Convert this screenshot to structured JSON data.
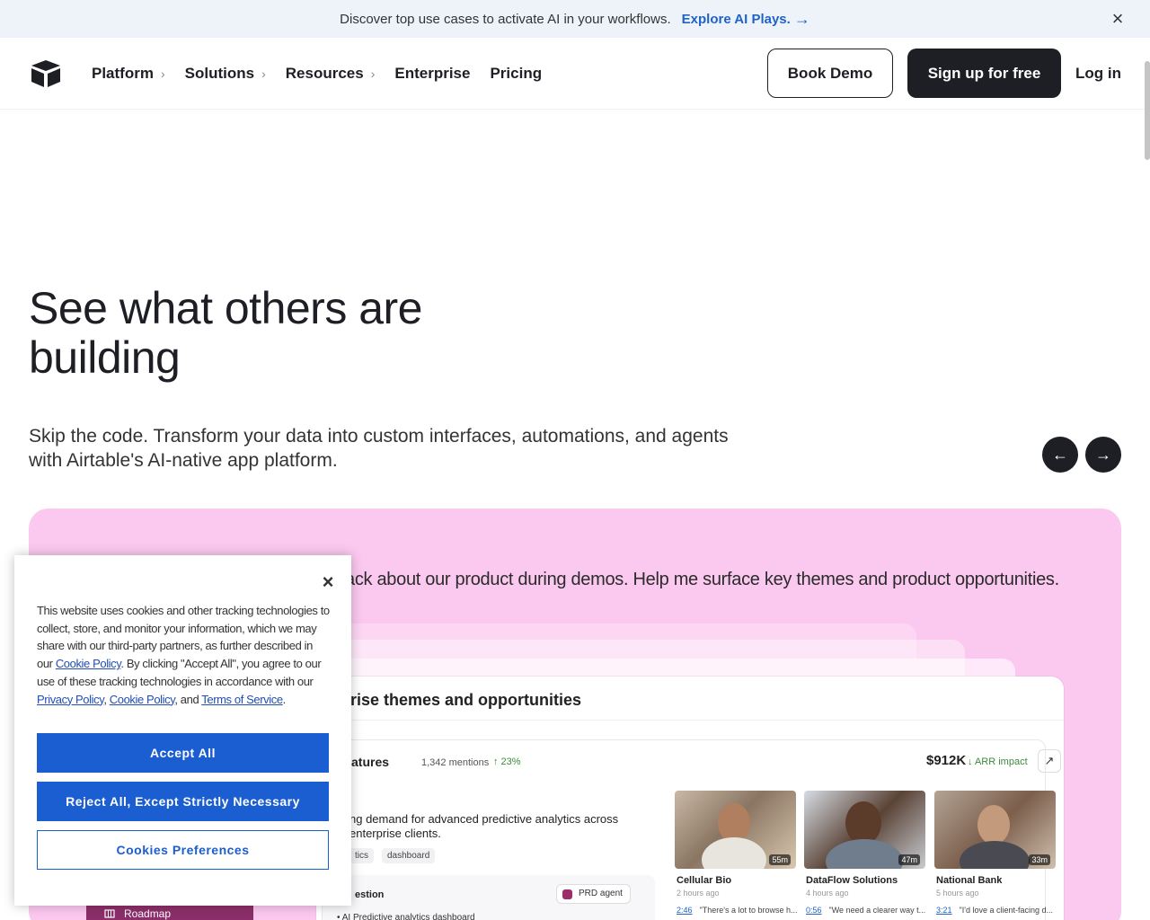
{
  "announcement": {
    "message": "Discover top use cases to activate AI in your workflows.",
    "cta": "Explore AI Plays.",
    "cta_arrow": "→",
    "close": "×"
  },
  "nav": {
    "items": [
      {
        "label": "Platform",
        "has_submenu": true
      },
      {
        "label": "Solutions",
        "has_submenu": true
      },
      {
        "label": "Resources",
        "has_submenu": true
      },
      {
        "label": "Enterprise",
        "has_submenu": false
      },
      {
        "label": "Pricing",
        "has_submenu": false
      }
    ],
    "chevron": "›",
    "book_demo": "Book Demo",
    "sign_up": "Sign up for free",
    "log_in": "Log in"
  },
  "hero": {
    "title": "See what others are building",
    "subtitle": "Skip the code. Transform your data into custom interfaces, automations, and agents with Airtable's AI-native app platform.",
    "prev_arrow": "←",
    "next_arrow": "→"
  },
  "showcase": {
    "prompt": "ack about our product during demos. Help me surface key themes and product opportunities.",
    "card_title": "rise themes and opportunities",
    "feature_title": "atures",
    "mentions": "1,342 mentions",
    "growth": "↑ 23%",
    "arr_value": "$912K",
    "arr_label": "↓ ARR impact",
    "external_icon": "↗",
    "description": "ng demand for advanced predictive analytics across enterprise clients.",
    "tags": [
      "tics",
      "dashboard"
    ],
    "suggestion_title": "estion",
    "prd_agent": "PRD agent",
    "suggestion_item": "• AI Predictive analytics dashboard",
    "videos": [
      {
        "name": "Cellular Bio",
        "time": "2 hours ago",
        "duration": "55m",
        "ts": "2:46",
        "quote": "\"There's a lot to browse h..."
      },
      {
        "name": "DataFlow Solutions",
        "time": "4 hours ago",
        "duration": "47m",
        "ts": "0:56",
        "quote": "\"We need a clearer way t..."
      },
      {
        "name": "National Bank",
        "time": "5 hours ago",
        "duration": "33m",
        "ts": "3:21",
        "quote": "\"I'd love a client-facing d..."
      }
    ],
    "sidebar_item": "Roadmap",
    "sidebar_icon": "roadmap-icon"
  },
  "cookie": {
    "close": "×",
    "text_1": "This website uses cookies and other tracking technologies to collect, store, and monitor your information, which we may share with our third-party partners, as further described in our ",
    "link_cookie_policy": "Cookie Policy",
    "text_2": ". By clicking \"Accept All\", you agree to our use of these tracking technologies in accordance with our ",
    "link_privacy_policy": "Privacy Policy",
    "text_3": ", ",
    "link_cookie_policy_2": "Cookie Policy",
    "text_4": ", and ",
    "link_terms": "Terms of Service",
    "text_5": ".",
    "accept_all": "Accept All",
    "reject_all": "Reject All, Except Strictly Necessary",
    "preferences": "Cookies Preferences"
  },
  "colors": {
    "brand_dark": "#1d1f25",
    "link_blue": "#1f63c6",
    "cookie_blue": "#1b5ed1",
    "showcase_pink": "#fbc8ef",
    "announcement_bg": "#eef3f9"
  }
}
